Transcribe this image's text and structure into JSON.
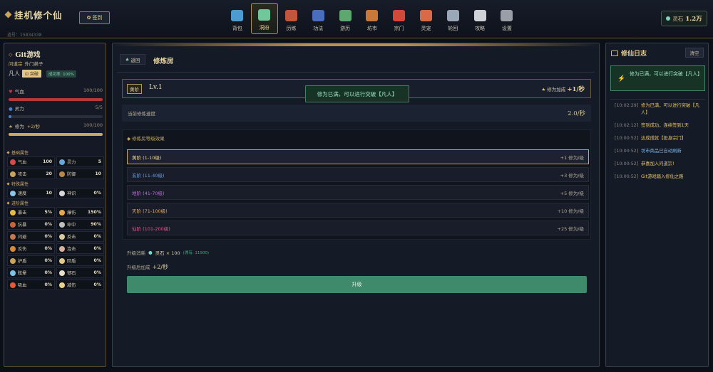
{
  "header": {
    "title": "挂机修个仙",
    "uid": "道号：15834338",
    "signin_label": "签到",
    "nav": [
      {
        "label": "背包",
        "icon": "bag-icon",
        "color": "#4c9bd1"
      },
      {
        "label": "洞府",
        "icon": "cave-icon",
        "color": "#6fc79a",
        "active": true
      },
      {
        "label": "历练",
        "icon": "swords-icon",
        "color": "#c2553d"
      },
      {
        "label": "功法",
        "icon": "scroll-icon",
        "color": "#4a6dbd"
      },
      {
        "label": "游历",
        "icon": "map-icon",
        "color": "#5da86f"
      },
      {
        "label": "坊市",
        "icon": "market-icon",
        "color": "#c9783a"
      },
      {
        "label": "宗门",
        "icon": "gate-icon",
        "color": "#cf4a37"
      },
      {
        "label": "灵宠",
        "icon": "pet-icon",
        "color": "#d86a4a"
      },
      {
        "label": "轮回",
        "icon": "cycle-icon",
        "color": "#9aa7b6"
      },
      {
        "label": "攻略",
        "icon": "book-icon",
        "color": "#cfd3d8"
      },
      {
        "label": "设置",
        "icon": "gear-icon",
        "color": "#9a9ea6"
      }
    ],
    "stones_label": "灵石",
    "stones_value": "1.2万"
  },
  "player": {
    "name": "Git游戏",
    "sect": "问道宗",
    "role": "外门弟子",
    "realm": "凡人",
    "breakthrough_label": "突破",
    "success_rate": "成功率: 100%",
    "bars": [
      {
        "label": "气血",
        "value": "100/100",
        "fraction": 1.0,
        "color": "#b43a37",
        "icon": "heart-icon"
      },
      {
        "label": "灵力",
        "value": "5/5",
        "fraction": 0.03,
        "color": "#4c7fc0",
        "icon": "orb-icon"
      },
      {
        "label": "修为",
        "extra": "+2/秒",
        "value": "100/100",
        "fraction": 1.0,
        "color": "#c9a860",
        "icon": "star-icon"
      }
    ]
  },
  "attributes": [
    {
      "title": "基础属性",
      "items": [
        {
          "label": "气血",
          "value": "100",
          "icon": "heart-icon",
          "color": "#d64b4b"
        },
        {
          "label": "灵力",
          "value": "5",
          "icon": "orb-icon",
          "color": "#6aa7d8"
        },
        {
          "label": "攻击",
          "value": "20",
          "icon": "sword-icon",
          "color": "#c9a45a"
        },
        {
          "label": "防御",
          "value": "10",
          "icon": "shield-icon",
          "color": "#b9874a"
        }
      ]
    },
    {
      "title": "特殊属性",
      "items": [
        {
          "label": "速度",
          "value": "10",
          "icon": "speed-icon",
          "color": "#8cc4e8"
        },
        {
          "label": "神识",
          "value": "0%",
          "icon": "yinyang-icon",
          "color": "#d8d8d8"
        }
      ]
    },
    {
      "title": "进阶属性",
      "items": [
        {
          "label": "暴击",
          "value": "5%",
          "icon": "crit-icon",
          "color": "#e8b94a"
        },
        {
          "label": "爆伤",
          "value": "150%",
          "icon": "sun-icon",
          "color": "#e8a84a"
        },
        {
          "label": "抗暴",
          "value": "0%",
          "icon": "shield-icon",
          "color": "#c7663d"
        },
        {
          "label": "命中",
          "value": "90%",
          "icon": "needle-icon",
          "color": "#bfbfbf"
        },
        {
          "label": "闪避",
          "value": "0%",
          "icon": "dodge-icon",
          "color": "#c27a52"
        },
        {
          "label": "反击",
          "value": "0%",
          "icon": "counter-icon",
          "color": "#d9c8a0"
        },
        {
          "label": "反伤",
          "value": "0%",
          "icon": "thorn-icon",
          "color": "#d88a3a"
        },
        {
          "label": "连击",
          "value": "0%",
          "icon": "combo-icon",
          "color": "#d8b0a0"
        },
        {
          "label": "护盾",
          "value": "0%",
          "icon": "guard-icon",
          "color": "#c9a45a"
        },
        {
          "label": "回盾",
          "value": "0%",
          "icon": "cloud-icon",
          "color": "#e0c890"
        },
        {
          "label": "眩晕",
          "value": "0%",
          "icon": "stun-icon",
          "color": "#7cc3e8"
        },
        {
          "label": "韧石",
          "value": "0%",
          "icon": "moon-icon",
          "color": "#e8e0c8"
        },
        {
          "label": "吸血",
          "value": "0%",
          "icon": "fire-icon",
          "color": "#e65a3a"
        },
        {
          "label": "减伤",
          "value": "0%",
          "icon": "bolt-icon",
          "color": "#e8d28a"
        }
      ]
    }
  ],
  "room": {
    "back_label": "返回",
    "title": "修炼房",
    "tier_tag": "黄阶",
    "level": "Lv.1",
    "bonus_label": "修为加成",
    "bonus_value": "+1/秒",
    "toast": "修为已满，可以进行突破【凡人】",
    "speed_label": "当前修炼速度",
    "speed_value": "2.0/秒",
    "tiers_heading": "修炼房等级效果",
    "tiers": [
      {
        "name": "黄阶 (1-10级)",
        "bonus": "+1 修为/级",
        "color": "#e8d59a",
        "selected": true
      },
      {
        "name": "玄阶 (11-40级)",
        "bonus": "+3 修为/级",
        "color": "#6f9fd8"
      },
      {
        "name": "地阶 (41-70级)",
        "bonus": "+5 修为/级",
        "color": "#b86fd0"
      },
      {
        "name": "天阶 (71-100级)",
        "bonus": "+10 修为/级",
        "color": "#d8a86a"
      },
      {
        "name": "仙阶 (101-200级)",
        "bonus": "+25 修为/级",
        "color": "#d85a8a"
      }
    ],
    "cost_label": "升级消耗",
    "cost_value": "灵石 × 100",
    "cost_hold": "(拥有: 11900)",
    "after_label": "升级后加成",
    "after_value": "+2/秒",
    "upgrade_label": "升级"
  },
  "log": {
    "title": "修仙日志",
    "clear_label": "清空",
    "notice": "修为已满，可以进行突破【凡人】",
    "entries": [
      {
        "time": "[10:02:29]",
        "msg": "修为已满，可以进行突破【凡人】",
        "style": "gold"
      },
      {
        "time": "[10:02:12]",
        "msg": "签到成功，连续签到1天",
        "style": "gold"
      },
      {
        "time": "[10:00:52]",
        "msg": "达成成就【投身宗门】",
        "style": "gold"
      },
      {
        "time": "[10:00:52]",
        "msg": "坊市商品已自动刷新",
        "style": "blue"
      },
      {
        "time": "[10:00:52]",
        "msg": "恭喜加入问道宗!",
        "style": "gold"
      },
      {
        "time": "[10:00:52]",
        "msg": "Git游戏踏入修仙之路",
        "style": "gold"
      }
    ]
  }
}
